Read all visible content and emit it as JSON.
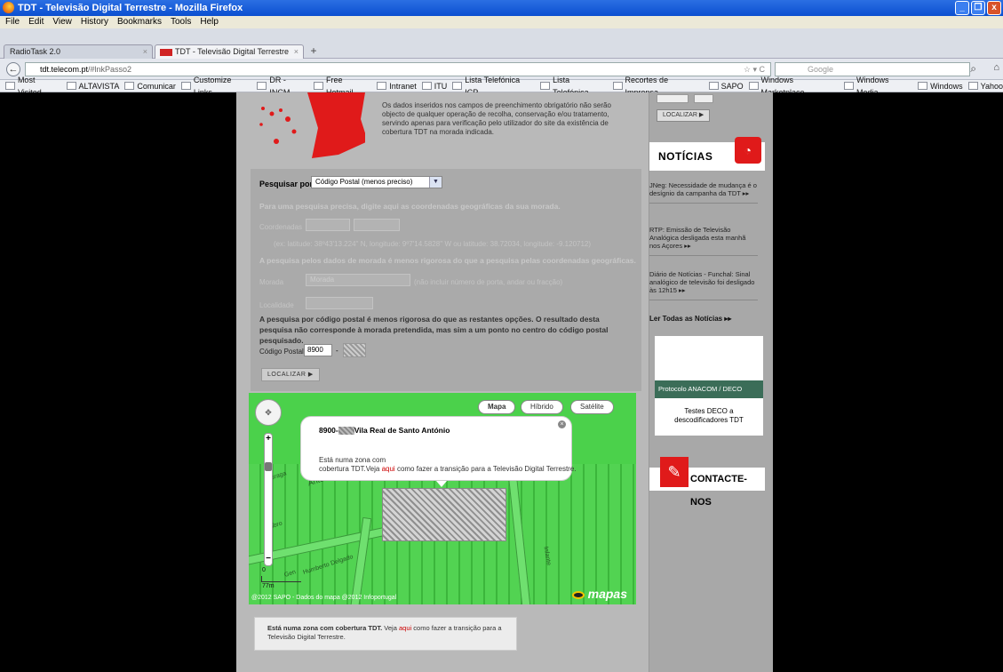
{
  "window": {
    "title": "TDT - Televisão Digital Terrestre - Mozilla Firefox",
    "buttons": [
      "_",
      "❐",
      "x"
    ]
  },
  "menu": [
    "File",
    "Edit",
    "View",
    "History",
    "Bookmarks",
    "Tools",
    "Help"
  ],
  "tabs": [
    {
      "label": "RadioTask 2.0",
      "close": "×"
    },
    {
      "label": "TDT - Televisão Digital Terrestre",
      "close": "×"
    }
  ],
  "newtab": "+",
  "nav": {
    "back": "←",
    "url_domain": "tdt.telecom.pt",
    "url_path": "/#lnkPasso2",
    "url_icons": "☆ ▾ C",
    "search_placeholder": "Google",
    "search_icon": "⌕",
    "home_icon": "⌂"
  },
  "bookmarks": [
    "Most Visited",
    "ALTAVISTA",
    "Comunicar",
    "Customize Links",
    "DR - INCM",
    "Free Hotmail",
    "Intranet",
    "ITU",
    "Lista Telefónica ICP",
    "Lista Telefónica",
    "Recortes de Imprensa",
    "SAPO",
    "Windows Marketplace",
    "Windows Media",
    "Windows",
    "Yahoo"
  ],
  "main": {
    "disclaimer": "Os dados inseridos nos campos de preenchimento obrigatório não serão objecto de qualquer operação de recolha, conservação e/ou tratamento, servindo apenas para verificação pelo utilizador do site da existência de cobertura TDT na morada indicada.",
    "search_by_label": "Pesquisar por",
    "search_by_value": "Código Postal (menos preciso)",
    "coords_hint": "Para uma pesquisa precisa, digite aqui as coordenadas geográficas da sua morada.",
    "coords_label": "Coordenadas",
    "coords_example": "(ex: latitude: 38º43'13.224'' N, longitude: 9º7'14.5828'' W ou latitude: 38.72034, longitude: -9.120712)",
    "address_hint": "A pesquisa pelos dados de morada é menos rigorosa do que a pesquisa pelas coordenadas geográficas.",
    "address_label": "Morada",
    "address_placeholder": "Morada",
    "address_note": "(não incluir número de porta, andar ou fracção)",
    "locality_label": "Localidade",
    "postal_warning": "A pesquisa por código postal é menos rigorosa do que as restantes opções. O resultado desta pesquisa não corresponde à morada pretendida, mas sim a um ponto no centro do código postal pesquisado.",
    "postal_label": "Código Postal:",
    "postal_value": "8900",
    "postal_dash": "-",
    "locate_button": "LOCALIZAR ▶"
  },
  "map": {
    "buttons": [
      "Mapa",
      "Híbrido",
      "Satélite"
    ],
    "nav_arrows": "✥",
    "zoom_in": "+",
    "zoom_out": "−",
    "popup_prefix": "8900-",
    "popup_place": "Vila Real de Santo António",
    "popup_text_1": "Está numa zona com",
    "popup_text_2": "cobertura TDT.Veja",
    "popup_link": "aqui",
    "popup_text_3": "como fazer a transição para a Televisão Digital Terrestre.",
    "popup_close": "×",
    "labels": [
      "Humberto Delgado",
      "Gen",
      "António",
      "Infante",
      "Tubro",
      "Braga"
    ],
    "scale_top": "0",
    "scale": "77m",
    "copyright": "@2012 SAPO - Dados do mapa @2012 Infoportugal",
    "brand": "mapas"
  },
  "result": {
    "bold": "Está numa zona com cobertura TDT.",
    "text_1": "Veja",
    "link": "aqui",
    "text_2": "como fazer a transição para a Televisão Digital Terrestre."
  },
  "sidebar": {
    "locate_button": "LOCALIZAR ▶",
    "news_heading": "NOTÍCIAS",
    "news": [
      "JNeg: Necessidade de mudança é o desígnio da campanha da TDT ▸▸",
      "RTP: Emissão de Televisão Analógica desligada esta manhã nos Açores ▸▸",
      "Diário de Notícias - Funchal: Sinal analógico de televisão foi desligado às 12h15 ▸▸"
    ],
    "all_news": "Ler Todas as Notícias ▸▸",
    "deco_banner": "Protocolo ANACOM / DECO",
    "deco_caption": "Testes DECO a descodificadores TDT",
    "contact": "CONTACTE-NOS"
  }
}
